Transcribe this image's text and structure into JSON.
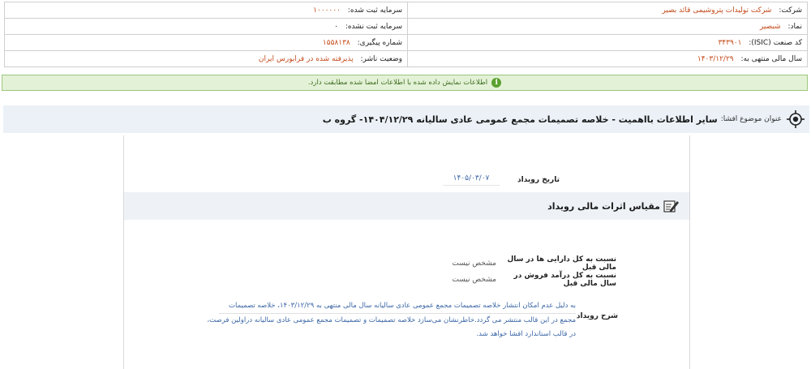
{
  "company_info": {
    "company_label": "شرکت:",
    "company_value": "شرکت تولیدات پتروشیمی قائد بصیر",
    "symbol_label": "نماد:",
    "symbol_value": "شبصیر",
    "isic_label": "کد صنعت (ISIC):",
    "isic_value": "۳۴۳۹۰۱",
    "fiscal_year_label": "سال مالی منتهی به:",
    "fiscal_year_value": "۱۴۰۳/۱۲/۲۹",
    "registered_capital_label": "سرمایه ثبت شده:",
    "registered_capital_value": "۱۰۰۰۰۰۰",
    "unregistered_capital_label": "سرمایه ثبت نشده:",
    "unregistered_capital_value": "۰",
    "tracking_label": "شماره پیگیری:",
    "tracking_value": "۱۵۵۸۱۳۸",
    "publisher_status_label": "وضعیت ناشر:",
    "publisher_status_value": "پذیرفته شده در فرابورس ایران"
  },
  "notice": {
    "icon": "info-icon",
    "text": "اطلاعات نمایش داده شده با اطلاعات امضا شده مطابقت دارد.",
    "color": "#e3f2d6"
  },
  "subject": {
    "icon": "target-icon",
    "label": "عنوان موضوع افشا:",
    "title": "سایر اطلاعات بااهمیت - خلاصه تصمیمات مجمع عمومی عادی سالیانه ۱۴۰۴/۱۲/۲۹- گروه ب"
  },
  "event": {
    "date_label": "تاریخ رویداد",
    "date_value": "۱۴۰۵/۰۳/۰۷"
  },
  "financial_effects": {
    "icon": "edit-icon",
    "title": "مقیاس اثرات مالی رویداد",
    "rows": [
      {
        "label": "نسبت به کل دارایی ها در سال مالی قبل",
        "value": "مشخص نیست"
      },
      {
        "label": "نسبت به کل درآمد فروش در سال مالی قبل",
        "value": "مشخص نیست"
      }
    ]
  },
  "description": {
    "label": "شرح رویداد",
    "lines": [
      "به دلیل عدم امکان انتشار خلاصه تصمیمات مجمع عمومی عادی سالیانه سال مالی منتهی به ۱۴۰۳/۱۲/۲۹، خلاصه تصمیمات",
      "مجمع در این قالب منتشر می گردد.خاطرنشان می‌سازد خلاصه تصمیمات و تصمیمات مجمع عمومی عادی سالیانه دراولین فرصت،",
      "در قالب استاندارد افشا خواهد شد."
    ]
  }
}
